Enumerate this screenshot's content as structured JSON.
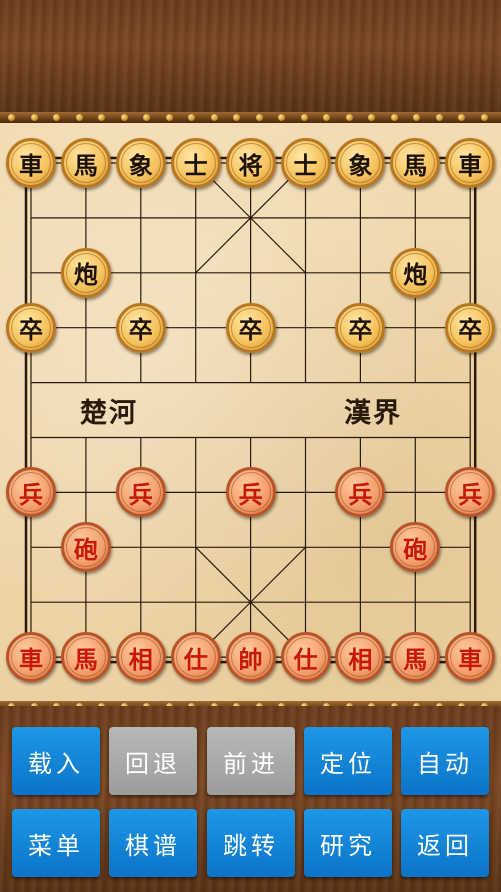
{
  "board": {
    "river_left": "楚河",
    "river_right": "漢界",
    "pieces": [
      {
        "side": "black",
        "label": "車",
        "col": 0,
        "row": 0
      },
      {
        "side": "black",
        "label": "馬",
        "col": 1,
        "row": 0
      },
      {
        "side": "black",
        "label": "象",
        "col": 2,
        "row": 0
      },
      {
        "side": "black",
        "label": "士",
        "col": 3,
        "row": 0
      },
      {
        "side": "black",
        "label": "将",
        "col": 4,
        "row": 0
      },
      {
        "side": "black",
        "label": "士",
        "col": 5,
        "row": 0
      },
      {
        "side": "black",
        "label": "象",
        "col": 6,
        "row": 0
      },
      {
        "side": "black",
        "label": "馬",
        "col": 7,
        "row": 0
      },
      {
        "side": "black",
        "label": "車",
        "col": 8,
        "row": 0
      },
      {
        "side": "black",
        "label": "炮",
        "col": 1,
        "row": 2
      },
      {
        "side": "black",
        "label": "炮",
        "col": 7,
        "row": 2
      },
      {
        "side": "black",
        "label": "卒",
        "col": 0,
        "row": 3
      },
      {
        "side": "black",
        "label": "卒",
        "col": 2,
        "row": 3
      },
      {
        "side": "black",
        "label": "卒",
        "col": 4,
        "row": 3
      },
      {
        "side": "black",
        "label": "卒",
        "col": 6,
        "row": 3
      },
      {
        "side": "black",
        "label": "卒",
        "col": 8,
        "row": 3
      },
      {
        "side": "red",
        "label": "兵",
        "col": 0,
        "row": 6
      },
      {
        "side": "red",
        "label": "兵",
        "col": 2,
        "row": 6
      },
      {
        "side": "red",
        "label": "兵",
        "col": 4,
        "row": 6
      },
      {
        "side": "red",
        "label": "兵",
        "col": 6,
        "row": 6
      },
      {
        "side": "red",
        "label": "兵",
        "col": 8,
        "row": 6
      },
      {
        "side": "red",
        "label": "砲",
        "col": 1,
        "row": 7
      },
      {
        "side": "red",
        "label": "砲",
        "col": 7,
        "row": 7
      },
      {
        "side": "red",
        "label": "車",
        "col": 0,
        "row": 9
      },
      {
        "side": "red",
        "label": "馬",
        "col": 1,
        "row": 9
      },
      {
        "side": "red",
        "label": "相",
        "col": 2,
        "row": 9
      },
      {
        "side": "red",
        "label": "仕",
        "col": 3,
        "row": 9
      },
      {
        "side": "red",
        "label": "帥",
        "col": 4,
        "row": 9
      },
      {
        "side": "red",
        "label": "仕",
        "col": 5,
        "row": 9
      },
      {
        "side": "red",
        "label": "相",
        "col": 6,
        "row": 9
      },
      {
        "side": "red",
        "label": "馬",
        "col": 7,
        "row": 9
      },
      {
        "side": "red",
        "label": "車",
        "col": 8,
        "row": 9
      }
    ]
  },
  "buttons": {
    "load": "载入",
    "undo": "回退",
    "forward": "前进",
    "locate": "定位",
    "auto": "自动",
    "menu": "菜单",
    "manual": "棋谱",
    "jump": "跳转",
    "study": "研究",
    "back": "返回"
  },
  "colors": {
    "button_blue": "#0b74c7",
    "button_disabled": "#a8a8a8",
    "red_piece_text": "#c81808",
    "black_piece_text": "#1d1108"
  }
}
